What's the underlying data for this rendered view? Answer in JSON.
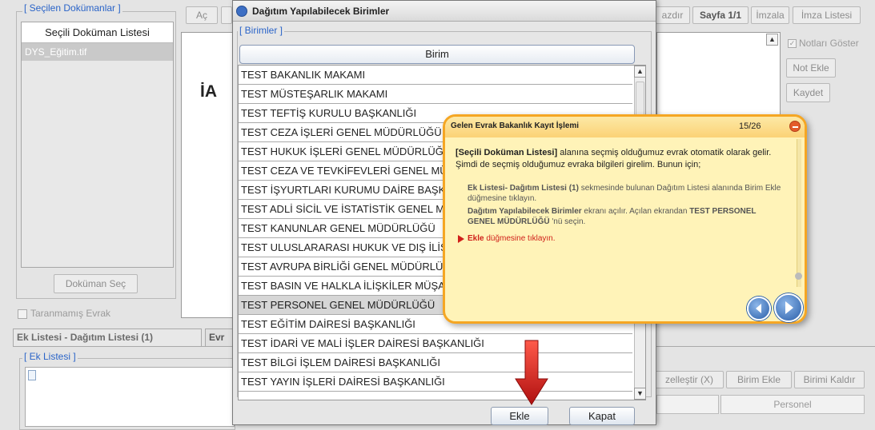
{
  "left_panel": {
    "legend": "[ Seçilen Dokümanlar ]",
    "list_title": "Seçili Doküman Listesi",
    "list_item": "DYS_Eğitim.tif",
    "button": "Doküman Seç",
    "checkbox_label": "Taranmamış Evrak"
  },
  "toolbar": {
    "ac": "Aç",
    "yazdir": "azdır",
    "sayfa": "Sayfa 1/1",
    "imzala": "İmzala",
    "imza_listesi": "İmza Listesi"
  },
  "preview": {
    "text": "İA"
  },
  "right_panel": {
    "notlari_goster": "Notları Göster",
    "not_ekle": "Not Ekle",
    "kaydet": "Kaydet"
  },
  "bottom": {
    "tab1": "Ek Listesi - Dağıtım Listesi (1)",
    "tab2": "Evr",
    "legend": "[ Ek Listesi ]",
    "ozellestir": "zelleştir (X)",
    "birim_ekle": "Birim Ekle",
    "birimi_kaldir": "Birimi Kaldır",
    "personel": "Personel"
  },
  "dialog": {
    "title": "Dağıtım Yapılabilecek Birimler",
    "legend": "[ Birimler ]",
    "column_header": "Birim",
    "rows": [
      "TEST BAKANLIK MAKAMI",
      "TEST MÜSTEŞARLIK  MAKAMI",
      "TEST TEFTİŞ KURULU BAŞKANLIĞI",
      "TEST CEZA İŞLERİ GENEL MÜDÜRLÜĞÜ",
      "TEST HUKUK İŞLERİ GENEL MÜDÜRLÜĞÜ",
      "TEST CEZA VE TEVKİFEVLERİ GENEL MÜDÜRLÜĞÜ",
      "TEST İŞYURTLARI KURUMU DAİRE BAŞKANLIĞI",
      "TEST ADLİ SİCİL VE İSTATİSTİK GENEL MÜDÜRLÜĞÜ",
      "TEST KANUNLAR GENEL MÜDÜRLÜĞÜ",
      "TEST ULUSLARARASI HUKUK VE DIŞ İLİŞKİLER",
      "TEST AVRUPA BİRLİĞİ GENEL MÜDÜRLÜĞÜ",
      "TEST BASIN VE HALKLA İLİŞKİLER MÜŞAVİRLİĞİ",
      "TEST PERSONEL GENEL MÜDÜRLÜĞÜ",
      "TEST EĞİTİM DAİRESİ BAŞKANLIĞI",
      "TEST İDARİ VE MALİ İŞLER DAİRESİ BAŞKANLIĞI",
      "TEST BİLGİ İŞLEM DAİRESİ BAŞKANLIĞI",
      "TEST YAYIN İŞLERİ DAİRESİ BAŞKANLIĞI"
    ],
    "selected_index": 12,
    "ekle": "Ekle",
    "kapat": "Kapat"
  },
  "tooltip": {
    "title": "Gelen Evrak Bakanlık Kayıt İşlemi",
    "step": "15/26",
    "intro_bold": "[Seçili Doküman Listesi]",
    "intro_rest": " alanına seçmiş olduğumuz evrak otomatik olarak gelir.  Şimdi de seçmiş olduğumuz evraka bilgileri girelim. Bunun için;",
    "s1_bold": "Ek Listesi- Dağıtım Listesi (1)",
    "s1_rest": " sekmesinde bulunan Dağıtım Listesi alanında Birim Ekle düğmesine tıklayın.",
    "s2_bold": "Dağıtım Yapılabilecek Birimler",
    "s2_mid": " ekranı açılır. Açılan ekrandan ",
    "s2_bold2": "TEST PERSONEL GENEL MÜDÜRLÜĞÜ",
    "s2_rest": " 'nü seçin.",
    "s3_bold": "Ekle",
    "s3_rest": " düğmesine tıklayın.",
    "colors": {
      "bg": "#fff3b8",
      "border": "#f5a623",
      "header": "#fbc65a",
      "red": "#d0201a"
    }
  }
}
